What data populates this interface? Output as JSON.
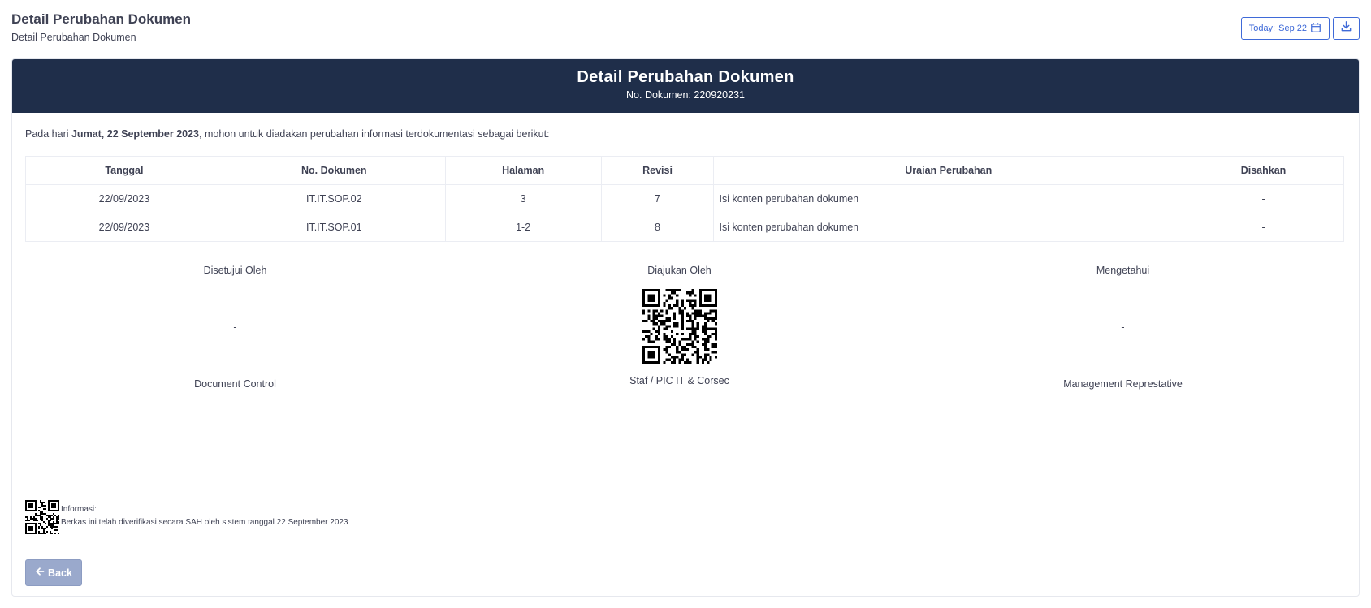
{
  "page": {
    "title": "Detail Perubahan Dokumen",
    "subtitle": "Detail Perubahan Dokumen"
  },
  "toolbar": {
    "today_label": "Today:",
    "today_value": "Sep 22",
    "calendar_icon": "calendar-icon",
    "download_icon": "download-icon"
  },
  "card": {
    "title": "Detail Perubahan Dokumen",
    "doc_no_label": "No. Dokumen:",
    "doc_no_value": "220920231"
  },
  "intro": {
    "prefix": "Pada hari ",
    "date": "Jumat, 22 September 2023",
    "suffix": ", mohon untuk diadakan perubahan informasi terdokumentasi sebagai berikut:"
  },
  "table": {
    "headers": [
      "Tanggal",
      "No. Dokumen",
      "Halaman",
      "Revisi",
      "Uraian Perubahan",
      "Disahkan"
    ],
    "rows": [
      [
        "22/09/2023",
        "IT.IT.SOP.02",
        "3",
        "7",
        "Isi konten perubahan dokumen",
        "-"
      ],
      [
        "22/09/2023",
        "IT.IT.SOP.01",
        "1-2",
        "8",
        "Isi konten perubahan dokumen",
        "-"
      ]
    ]
  },
  "signatures": [
    {
      "role": "Disetujui Oleh",
      "value": "-",
      "name": "Document Control"
    },
    {
      "role": "Diajukan Oleh",
      "value": "",
      "name": "Staf / PIC IT & Corsec"
    },
    {
      "role": "Mengetahui",
      "value": "-",
      "name": "Management Represtative"
    }
  ],
  "footer": {
    "info_label": "Informasi:",
    "info_text": "Berkas ini telah diverifikasi secara SAH oleh sistem tanggal 22 September 2023"
  },
  "actions": {
    "back_label": "Back",
    "back_icon": "arrow-left-icon"
  },
  "colors": {
    "header_bg": "#1f2e4a",
    "accent": "#3f6ad8",
    "back_button": "#9aa9cc"
  }
}
